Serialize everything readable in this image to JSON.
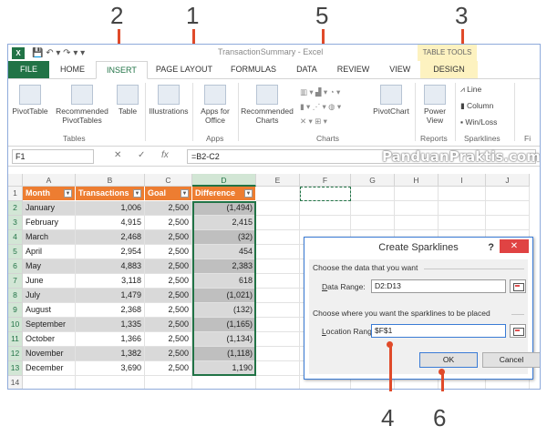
{
  "callouts": [
    "2",
    "1",
    "5",
    "3",
    "4",
    "6"
  ],
  "titlebar": {
    "app_icon": "X",
    "quick_access": "💾  ↶ ▾  ↷ ▾  ▾",
    "title": "TransactionSummary - Excel",
    "table_tools": "TABLE TOOLS"
  },
  "tabs": [
    "FILE",
    "HOME",
    "INSERT",
    "PAGE LAYOUT",
    "FORMULAS",
    "DATA",
    "REVIEW",
    "VIEW",
    "DESIGN"
  ],
  "ribbon": {
    "pivottable": "PivotTable",
    "recommended_pivot": "Recommended PivotTables",
    "table": "Table",
    "tables_group": "Tables",
    "illustrations": "Illustrations",
    "apps_for_office": "Apps for Office",
    "apps_group": "Apps",
    "recommended_charts": "Recommended Charts",
    "charts_group": "Charts",
    "pivotchart": "PivotChart",
    "power_view": "Power View",
    "reports_group": "Reports",
    "line": "Line",
    "column": "Column",
    "win_loss": "Win/Loss",
    "sparklines_group": "Sparklines",
    "fi_group": "Fi"
  },
  "formula_bar": {
    "name_box": "F1",
    "fx": "fx",
    "formula": "=B2-C2",
    "watermark": "PanduanPraktis.com"
  },
  "columns": [
    "A",
    "B",
    "C",
    "D",
    "E",
    "F",
    "G",
    "H",
    "I",
    "J"
  ],
  "table": {
    "headers": [
      "Month",
      "Transactions",
      "Goal",
      "Difference"
    ],
    "rows": [
      [
        "January",
        "1,006",
        "2,500",
        "(1,494)"
      ],
      [
        "February",
        "4,915",
        "2,500",
        "2,415"
      ],
      [
        "March",
        "2,468",
        "2,500",
        "(32)"
      ],
      [
        "April",
        "2,954",
        "2,500",
        "454"
      ],
      [
        "May",
        "4,883",
        "2,500",
        "2,383"
      ],
      [
        "June",
        "3,118",
        "2,500",
        "618"
      ],
      [
        "July",
        "1,479",
        "2,500",
        "(1,021)"
      ],
      [
        "August",
        "2,368",
        "2,500",
        "(132)"
      ],
      [
        "September",
        "1,335",
        "2,500",
        "(1,165)"
      ],
      [
        "October",
        "1,366",
        "2,500",
        "(1,134)"
      ],
      [
        "November",
        "1,382",
        "2,500",
        "(1,118)"
      ],
      [
        "December",
        "3,690",
        "2,500",
        "1,190"
      ]
    ]
  },
  "row_numbers": [
    "1",
    "2",
    "3",
    "4",
    "5",
    "6",
    "7",
    "8",
    "9",
    "10",
    "11",
    "12",
    "13",
    "14"
  ],
  "dialog": {
    "title": "Create Sparklines",
    "help": "?",
    "close": "✕",
    "section1": "Choose the data that you want",
    "data_range_label": "Data Range:",
    "data_range_value": "D2:D13",
    "section2": "Choose where you want the sparklines to be placed",
    "location_range_label": "Location Range:",
    "location_range_value": "$F$1",
    "ok": "OK",
    "cancel": "Cancel"
  },
  "colors": {
    "excel_green": "#217346",
    "table_header": "#ed7d31",
    "callout": "#e04a2a",
    "band": "#d9d9d9"
  }
}
